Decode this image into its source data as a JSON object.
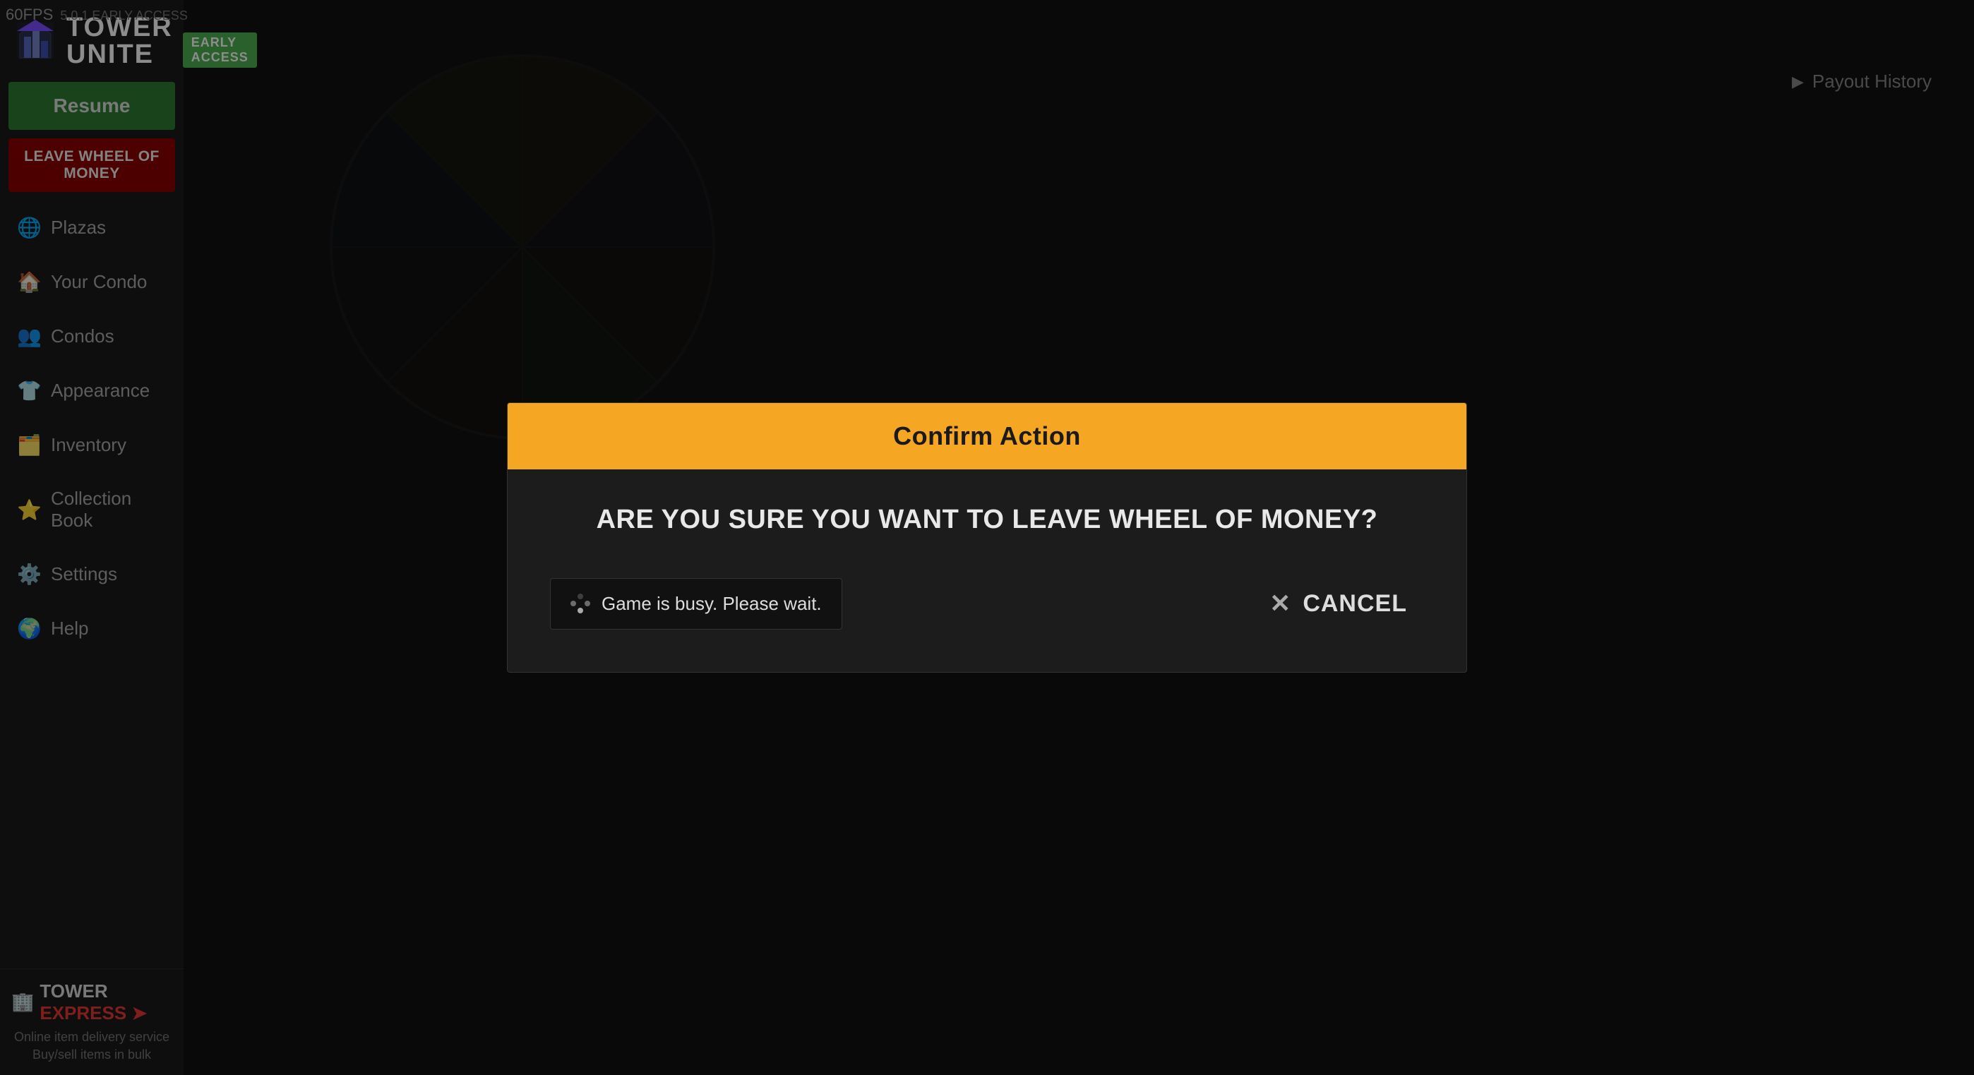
{
  "fps": "60FPS",
  "version": "5.0.1 EARLY ACCESS",
  "logo": {
    "tower": "TOWER",
    "unite": "UNITE",
    "early_access": "EARLY ACCESS"
  },
  "sidebar": {
    "resume_label": "Resume",
    "leave_label": "LEAVE WHEEL OF MONEY",
    "nav_items": [
      {
        "id": "plazas",
        "label": "Plazas",
        "icon": "🌐"
      },
      {
        "id": "your-condo",
        "label": "Your Condo",
        "icon": "🏠"
      },
      {
        "id": "condos",
        "label": "Condos",
        "icon": "👥"
      },
      {
        "id": "appearance",
        "label": "Appearance",
        "icon": "👕"
      },
      {
        "id": "inventory",
        "label": "Inventory",
        "icon": "🗂️"
      },
      {
        "id": "collection-book",
        "label": "Collection Book",
        "icon": "⭐"
      },
      {
        "id": "settings",
        "label": "Settings",
        "icon": "⚙️"
      },
      {
        "id": "help",
        "label": "Help",
        "icon": "🌍"
      }
    ],
    "tower_express": {
      "label": "TOWER",
      "express_label": "EXPRESS",
      "desc_line1": "Online item delivery service",
      "desc_line2": "Buy/sell items in bulk"
    }
  },
  "payout_history": {
    "label": "Payout History"
  },
  "dialog": {
    "header": "Confirm Action",
    "question": "ARE YOU SURE YOU WANT TO LEAVE WHEEL OF MONEY?",
    "busy_msg": "Game is busy. Please wait.",
    "cancel_label": "CANCEL"
  }
}
